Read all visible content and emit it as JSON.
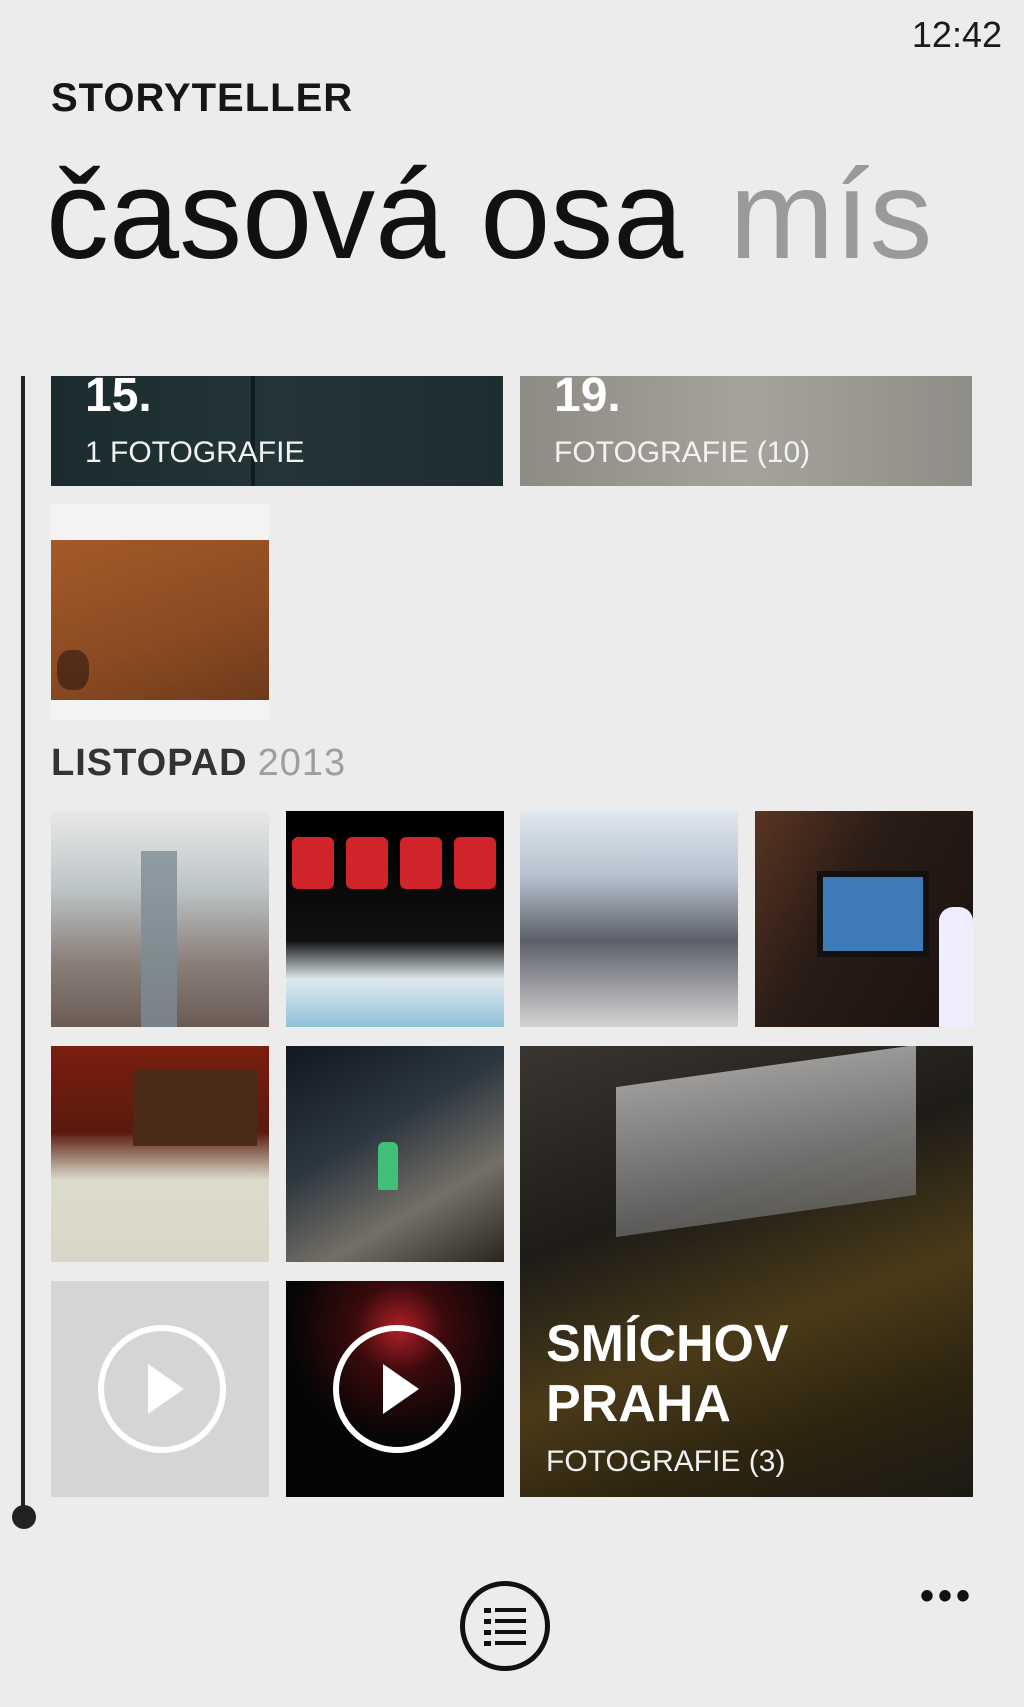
{
  "status_bar": {
    "time": "12:42"
  },
  "app": {
    "title": "STORYTELLER"
  },
  "pivot": {
    "active": "časová osa",
    "next": "mís"
  },
  "timeline": {
    "days": [
      {
        "day": "15.",
        "count": "1 FOTOGRAFIE"
      },
      {
        "day": "19.",
        "count": "FOTOGRAFIE (10)"
      }
    ],
    "section": {
      "month": "LISTOPAD",
      "year": "2013"
    },
    "place": {
      "name_line1": "SMÍCHOV",
      "name_line2": "PRAHA",
      "count": "FOTOGRAFIE (3)"
    }
  },
  "icons": {
    "play": "play-icon",
    "list": "list-icon",
    "more": "more-icon"
  },
  "appbar": {
    "more_label": "•••"
  },
  "colors": {
    "background": "#ececec",
    "text": "#161616",
    "inactive_pivot": "#9a9a9a"
  }
}
